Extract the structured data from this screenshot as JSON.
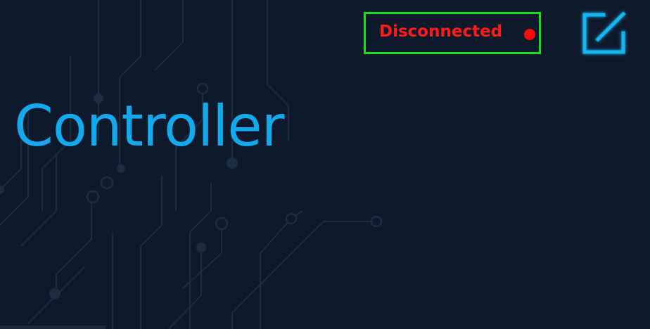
{
  "header": {
    "connection_status": "Disconnected",
    "status_color": "#ff1a1a",
    "status_border_color": "#16e01c",
    "edit_icon": "edit-icon"
  },
  "main": {
    "title": "Controller",
    "title_color": "#14a9ec"
  },
  "background": {
    "color": "#0e1a2b",
    "pattern": "circuit-board"
  }
}
